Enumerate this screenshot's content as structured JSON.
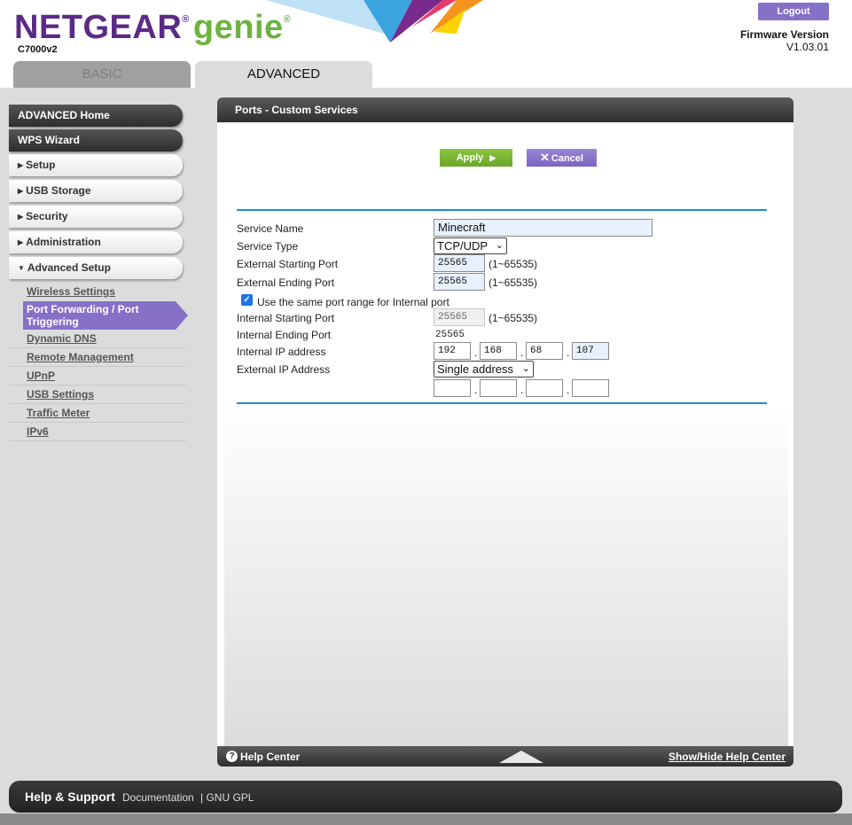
{
  "header": {
    "brand": "NETGEAR",
    "brand_mark": "®",
    "product": "genie",
    "product_mark": "®",
    "model": "C7000v2",
    "logout_label": "Logout",
    "firmware_label": "Firmware Version",
    "firmware_value": "V1.03.01"
  },
  "tabs": {
    "basic": "BASIC",
    "advanced": "ADVANCED"
  },
  "sidebar": {
    "advanced_home": "ADVANCED Home",
    "wps_wizard": "WPS Wizard",
    "sections": [
      "Setup",
      "USB Storage",
      "Security",
      "Administration",
      "Advanced Setup"
    ],
    "sub_items": [
      "Wireless Settings",
      "Port Forwarding / Port Triggering",
      "Dynamic DNS",
      "Remote Management",
      "UPnP",
      "USB Settings",
      "Traffic Meter",
      "IPv6"
    ]
  },
  "panel": {
    "title": "Ports - Custom Services",
    "apply_label": "Apply",
    "cancel_label": "Cancel",
    "form": {
      "service_name_label": "Service Name",
      "service_name_value": "Minecraft",
      "service_type_label": "Service Type",
      "service_type_value": "TCP/UDP",
      "ext_start_label": "External Starting Port",
      "ext_start_value": "25565",
      "ext_start_range": "(1~65535)",
      "ext_end_label": "External Ending Port",
      "ext_end_value": "25565",
      "ext_end_range": "(1~65535)",
      "same_range_label": "Use the same port range for Internal port",
      "int_start_label": "Internal Starting Port",
      "int_start_value": "25565",
      "int_start_range": "(1~65535)",
      "int_end_label": "Internal Ending Port",
      "int_end_value": "25565",
      "int_ip_label": "Internal IP address",
      "int_ip": [
        "192",
        "168",
        "68",
        "107"
      ],
      "ext_ip_label": "External IP Address",
      "ext_ip_mode": "Single address",
      "ext_ip": [
        "",
        "",
        "",
        ""
      ]
    },
    "help_center": "Help Center",
    "show_hide": "Show/Hide Help Center"
  },
  "footer": {
    "help_support": "Help & Support",
    "documentation": "Documentation",
    "gpl": "| GNU GPL"
  },
  "colors": {
    "brand_purple": "#5b2a86",
    "genie_green": "#6db33f",
    "accent_purple": "#8670c8",
    "apply_green": "#7ab733",
    "divider_blue": "#1e90c8"
  }
}
